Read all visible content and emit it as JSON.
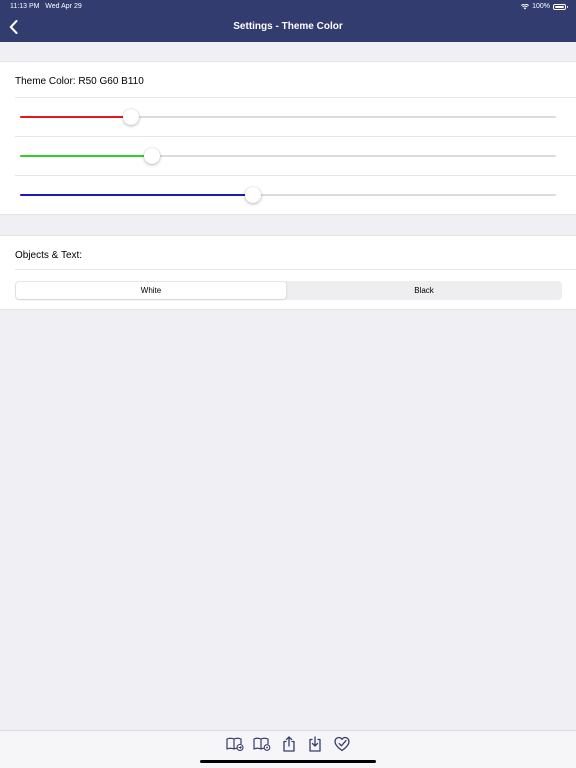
{
  "status_bar": {
    "time": "11:13 PM",
    "date": "Wed Apr 29",
    "battery": "100%"
  },
  "nav": {
    "title": "Settings - Theme Color",
    "back_icon": "chevron-left-icon"
  },
  "theme": {
    "label": "Theme Color: R50 G60 B110",
    "sliders": [
      {
        "name": "red",
        "color": "#e0191b",
        "fraction": 0.208
      },
      {
        "name": "green",
        "color": "#2fcf2c",
        "fraction": 0.246
      },
      {
        "name": "blue",
        "color": "#1a1ab4",
        "fraction": 0.435
      }
    ]
  },
  "objects_text": {
    "label": "Objects & Text:",
    "options": [
      "White",
      "Black"
    ],
    "selected": "White"
  },
  "toolbar": {
    "icons": [
      "book-forward-icon",
      "book-settings-icon",
      "share-upload-icon",
      "download-icon",
      "heart-check-icon"
    ]
  },
  "colors": {
    "nav_background": "#323c6e",
    "page_background": "#efeff4",
    "icon_color": "#323c6e"
  }
}
